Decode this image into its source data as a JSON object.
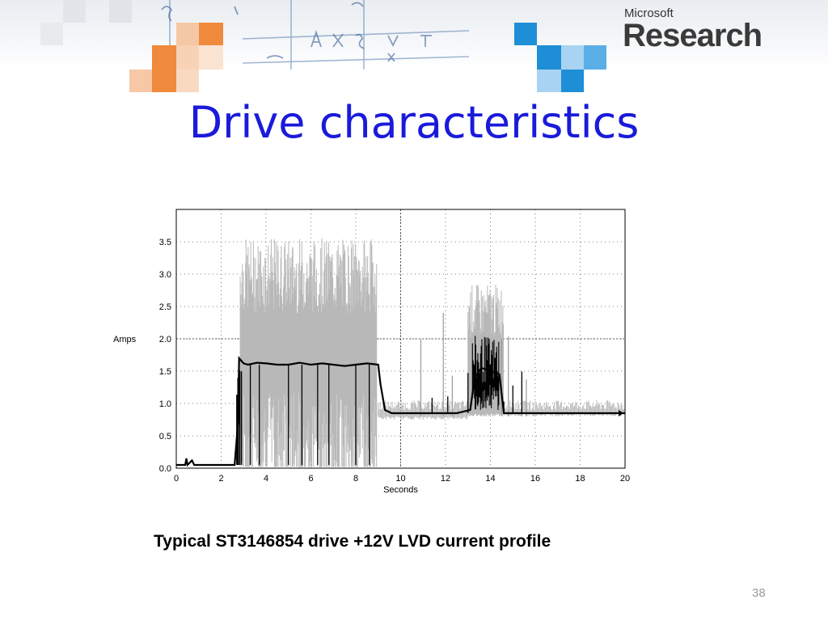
{
  "slide": {
    "title": "Drive characteristics",
    "caption": "Typical ST3146854 drive +12V LVD current profile",
    "page_number": "38"
  },
  "logo": {
    "small": "Microsoft",
    "big": "Research"
  },
  "colors": {
    "title": "#1a1adb",
    "envelope": "#b8b8b8",
    "trace": "#000000",
    "orange_squares": "#f08a3c",
    "blue_squares": "#1e8fd6"
  },
  "chart_data": {
    "type": "line",
    "xlabel": "Seconds",
    "ylabel": "Amps",
    "xlim": [
      0,
      20
    ],
    "ylim": [
      0,
      4
    ],
    "x_ticks": [
      "0",
      "2",
      "4",
      "6",
      "8",
      "10",
      "12",
      "14",
      "16",
      "18",
      "20"
    ],
    "y_ticks": [
      "0.0",
      "0.5",
      "1.0",
      "1.5",
      "2.0",
      "2.5",
      "3.0",
      "3.5"
    ],
    "grid": true,
    "series": [
      {
        "values": [
          [
            0,
            0.05
          ],
          [
            0.4,
            0.05
          ],
          [
            0.45,
            0.15
          ],
          [
            0.5,
            0.05
          ],
          [
            0.7,
            0.12
          ],
          [
            0.8,
            0.05
          ],
          [
            2.6,
            0.05
          ],
          [
            2.75,
            0.7
          ],
          [
            2.8,
            1.7
          ],
          [
            3.0,
            1.62
          ],
          [
            3.2,
            1.6
          ],
          [
            3.6,
            1.63
          ],
          [
            4.0,
            1.62
          ],
          [
            4.5,
            1.6
          ],
          [
            5.0,
            1.6
          ],
          [
            5.5,
            1.63
          ],
          [
            6.0,
            1.6
          ],
          [
            6.5,
            1.62
          ],
          [
            7.0,
            1.6
          ],
          [
            7.5,
            1.58
          ],
          [
            8.0,
            1.6
          ],
          [
            8.5,
            1.62
          ],
          [
            9.0,
            1.6
          ],
          [
            9.1,
            1.3
          ],
          [
            9.3,
            0.9
          ],
          [
            9.6,
            0.85
          ],
          [
            10.5,
            0.85
          ],
          [
            11.5,
            0.85
          ],
          [
            12.5,
            0.85
          ],
          [
            13.1,
            0.9
          ],
          [
            13.3,
            1.4
          ],
          [
            13.6,
            1.55
          ],
          [
            14.0,
            1.5
          ],
          [
            14.4,
            1.45
          ],
          [
            14.6,
            0.85
          ],
          [
            16.0,
            0.85
          ],
          [
            17.0,
            0.85
          ],
          [
            18.0,
            0.85
          ],
          [
            19.0,
            0.85
          ],
          [
            20.0,
            0.85
          ]
        ]
      }
    ]
  }
}
